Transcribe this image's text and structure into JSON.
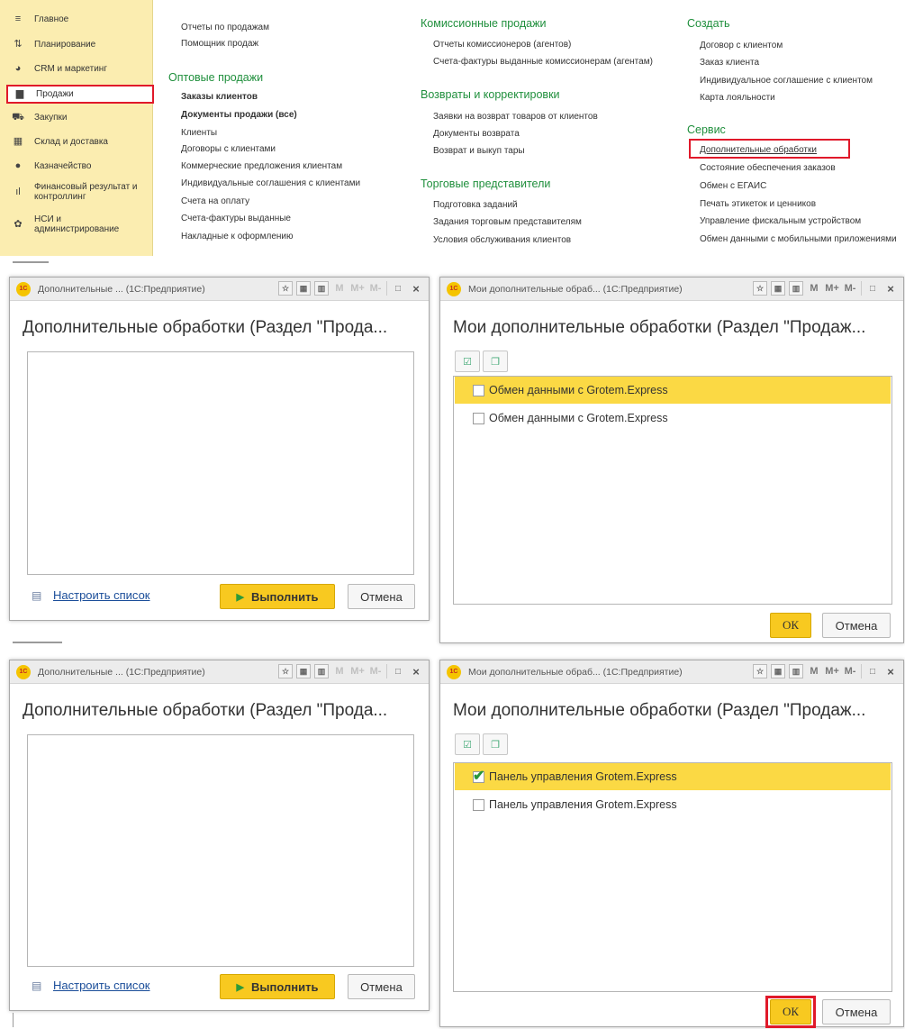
{
  "sidebar": {
    "items": [
      {
        "label": "Главное",
        "icon": "menu-icon"
      },
      {
        "label": "Планирование",
        "icon": "planning-icon"
      },
      {
        "label": "CRM и маркетинг",
        "icon": "crm-icon"
      },
      {
        "label": "Продажи",
        "icon": "bag-icon",
        "active": true
      },
      {
        "label": "Закупки",
        "icon": "cart-icon"
      },
      {
        "label": "Склад и доставка",
        "icon": "warehouse-icon"
      },
      {
        "label": "Казначейство",
        "icon": "coin-icon"
      },
      {
        "label": "Финансовый результат и контроллинг",
        "icon": "chart-icon"
      },
      {
        "label": "НСИ и администрирование",
        "icon": "gear-icon"
      }
    ]
  },
  "menu": {
    "col1": {
      "top_links": [
        "Отчеты по продажам",
        "Помощник продаж"
      ],
      "group": "Оптовые продажи",
      "links": [
        "Заказы клиентов",
        "Документы продажи (все)",
        "Клиенты",
        "Договоры с клиентами",
        "Коммерческие предложения клиентам",
        "Индивидуальные соглашения с клиентами",
        "Счета на оплату",
        "Счета-фактуры выданные",
        "Накладные к оформлению"
      ]
    },
    "col2": {
      "g1": "Комиссионные продажи",
      "g1_links": [
        "Отчеты комиссионеров (агентов)",
        "Счета-фактуры выданные комиссионерам (агентам)"
      ],
      "g2": "Возвраты и корректировки",
      "g2_links": [
        "Заявки на возврат товаров от клиентов",
        "Документы возврата",
        "Возврат и выкуп тары"
      ],
      "g3": "Торговые представители",
      "g3_links": [
        "Подготовка заданий",
        "Задания торговым представителям",
        "Условия обслуживания клиентов"
      ]
    },
    "col3": {
      "g1": "Создать",
      "g1_links": [
        "Договор с клиентом",
        "Заказ клиента",
        "Индивидуальное соглашение с клиентом",
        "Карта лояльности"
      ],
      "g2": "Сервис",
      "g2_links": [
        "Дополнительные обработки",
        "Состояние обеспечения заказов",
        "Обмен с ЕГАИС",
        "Печать этикеток и ценников",
        "Управление фискальным устройством",
        "Обмен данными с мобильными приложениями"
      ]
    }
  },
  "window_controls": {
    "logo": "1С",
    "m": "M",
    "m_plus": "M+",
    "m_minus": "M-",
    "restore": "□",
    "close": "×"
  },
  "dialog_left": {
    "title": "Дополнительные ... (1С:Предприятие)",
    "heading": "Дополнительные обработки (Раздел \"Прода...",
    "configure_link": "Настроить список",
    "run_label": "Выполнить",
    "cancel_label": "Отмена"
  },
  "dialog_right": {
    "title": "Мои дополнительные обраб... (1С:Предприятие)",
    "heading": "Мои дополнительные обработки (Раздел \"Продаж...",
    "ok_label": "ОК",
    "cancel_label": "Отмена"
  },
  "list_top": [
    {
      "label": "Обмен данными с Grotem.Express",
      "checked": false,
      "selected": true
    },
    {
      "label": "Обмен данными с Grotem.Express",
      "checked": false,
      "selected": false
    }
  ],
  "list_bottom": [
    {
      "label": "Панель управления Grotem.Express",
      "checked": true,
      "selected": true
    },
    {
      "label": "Панель управления Grotem.Express",
      "checked": false,
      "selected": false
    }
  ],
  "colors": {
    "sidebar_bg": "#fbedb0",
    "group_heading": "#1f8f3c",
    "selection": "#fbd944",
    "button_yellow": "#f8c920",
    "highlight_red": "#e0192a"
  }
}
